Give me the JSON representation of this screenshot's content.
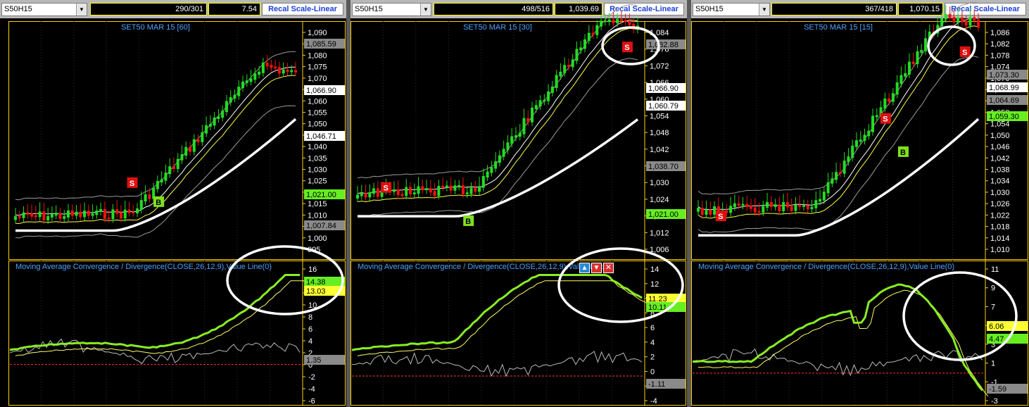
{
  "panels": [
    {
      "symbol": "S50H15",
      "counter": "290/301",
      "value": "7.54",
      "recal_label": "Recal Scale-Linear",
      "chart_title": "SET50 MAR 15  [60]",
      "price_ticks": [
        "1,090",
        "1,085",
        "1,080",
        "1,075",
        "1,070",
        "1,065",
        "1,060",
        "1,055",
        "1,050",
        "1,045",
        "1,040",
        "1,035",
        "1,030",
        "1,025",
        "1,020",
        "1,015",
        "1,010",
        "1,005",
        "1,000",
        "995"
      ],
      "price_labels": [
        {
          "text": "1,085.59",
          "style": "gray"
        },
        {
          "text": "1,066.90",
          "style": "white"
        },
        {
          "text": "1,046.71",
          "style": "white"
        },
        {
          "text": "1,021.00",
          "style": "green"
        },
        {
          "text": "1,007.84",
          "style": "gray"
        }
      ],
      "macd_title": "Moving Average Convergence / Divergence(CLOSE,26,12,9),Value Line(0)",
      "macd_ticks": [
        "16",
        "14",
        "12",
        "10",
        "8",
        "6",
        "4",
        "2",
        "0",
        "-2",
        "-4",
        "-6"
      ],
      "macd_labels": [
        {
          "text": "14.38",
          "style": "green"
        },
        {
          "text": "13.03",
          "style": "yellow"
        },
        {
          "text": "1.35",
          "style": "gray"
        }
      ],
      "markers": [
        {
          "text": "S",
          "color": "#e01010"
        },
        {
          "text": "B",
          "color": "#7fe020"
        }
      ]
    },
    {
      "symbol": "S50H15",
      "counter": "498/516",
      "value": "1,039.69",
      "recal_label": "Recal Scale-Linear",
      "chart_title": "SET50 MAR 15  [30]",
      "price_ticks": [
        "1,084",
        "1,078",
        "1,072",
        "1,066",
        "1,060",
        "1,054",
        "1,048",
        "1,042",
        "1,036",
        "1,030",
        "1,024",
        "1,018",
        "1,012",
        "1,006"
      ],
      "price_labels": [
        {
          "text": "1,082.88",
          "style": "gray"
        },
        {
          "text": "1,066.90",
          "style": "white"
        },
        {
          "text": "1,060.79",
          "style": "white"
        },
        {
          "text": "1,038.70",
          "style": "gray"
        },
        {
          "text": "1,021.00",
          "style": "green"
        }
      ],
      "macd_title": "Moving Average Convergence / Divergence(CLOSE,26,12,9),Value Line(0)",
      "macd_ticks": [
        "14",
        "12",
        "10",
        "8",
        "6",
        "4",
        "2",
        "0",
        "-2",
        "-4"
      ],
      "macd_labels": [
        {
          "text": "11.23",
          "style": "yellow"
        },
        {
          "text": "10.11",
          "style": "green"
        },
        {
          "text": "-1.11",
          "style": "gray"
        }
      ],
      "markers": [
        {
          "text": "S",
          "color": "#e01010"
        },
        {
          "text": "B",
          "color": "#7fe020"
        },
        {
          "text": "S",
          "color": "#e01010"
        }
      ]
    },
    {
      "symbol": "S50H15",
      "counter": "367/418",
      "value": "1,070.15",
      "recal_label": "Recal Scale-Linear",
      "chart_title": "SET50 MAR 15  [15]",
      "price_ticks": [
        "1,086",
        "1,082",
        "1,078",
        "1,074",
        "1,070",
        "1,066",
        "1,062",
        "1,058",
        "1,054",
        "1,050",
        "1,046",
        "1,042",
        "1,038",
        "1,034",
        "1,030",
        "1,026",
        "1,022",
        "1,018",
        "1,014",
        "1,010"
      ],
      "price_labels": [
        {
          "text": "1,073.30",
          "style": "gray"
        },
        {
          "text": "1,068.99",
          "style": "white"
        },
        {
          "text": "1,064.69",
          "style": "gray"
        },
        {
          "text": "1,059.30",
          "style": "green"
        }
      ],
      "macd_title": "Moving Average Convergence / Divergence(CLOSE,26,12,9),Value Line(0)",
      "macd_ticks": [
        "11",
        "9",
        "7",
        "5",
        "3",
        "1",
        "-1",
        "-3"
      ],
      "macd_labels": [
        {
          "text": "6.06",
          "style": "yellow"
        },
        {
          "text": "4.47",
          "style": "green"
        },
        {
          "text": "-1.59",
          "style": "gray"
        }
      ],
      "markers": [
        {
          "text": "S",
          "color": "#e01010"
        },
        {
          "text": "S",
          "color": "#e01010"
        },
        {
          "text": "B",
          "color": "#7fe020"
        },
        {
          "text": "S",
          "color": "#e01010"
        }
      ]
    }
  ],
  "colors": {
    "up": "#22dd22",
    "down": "#ee1111",
    "ema_fast": "#ffffff",
    "ema_slow": "#ffff44",
    "macd": "#88ee22",
    "signal": "#ffff66"
  }
}
